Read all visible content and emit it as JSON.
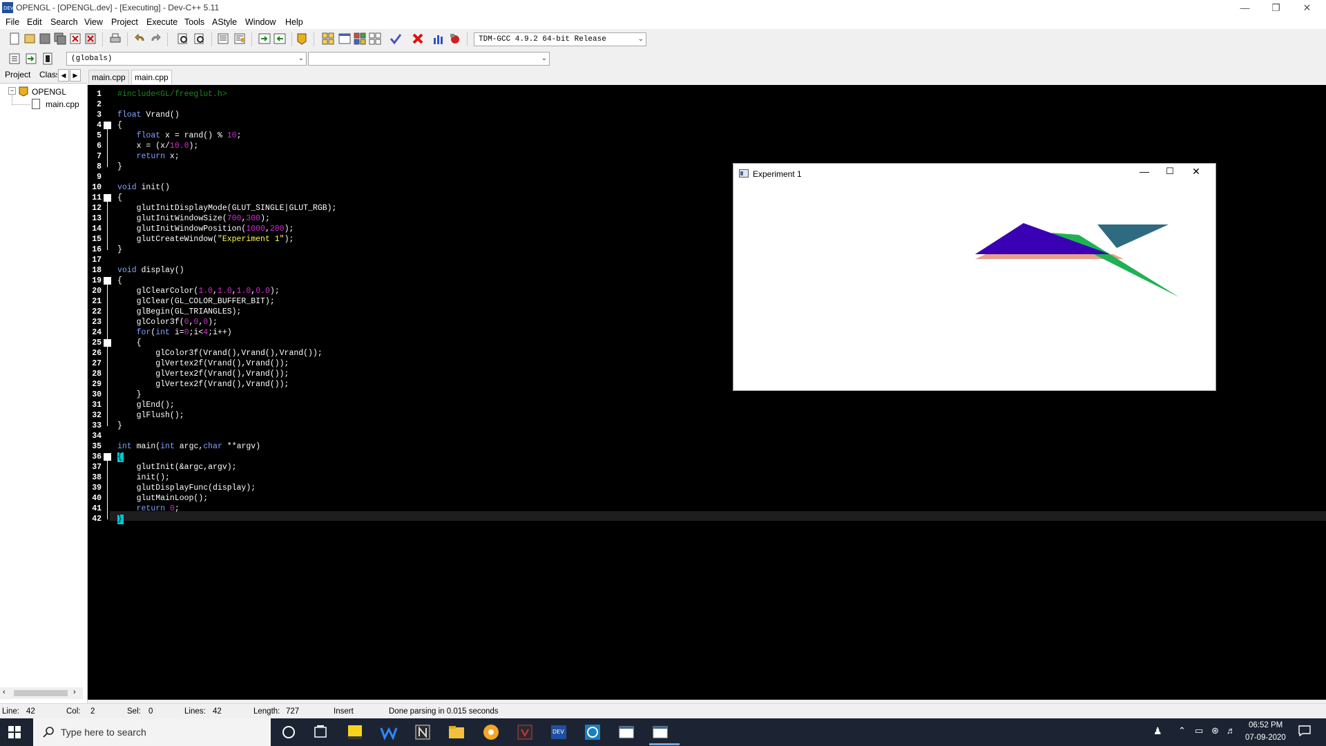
{
  "window": {
    "title": "OPENGL - [OPENGL.dev] - [Executing] - Dev-C++ 5.11"
  },
  "menu": [
    "File",
    "Edit",
    "Search",
    "View",
    "Project",
    "Execute",
    "Tools",
    "AStyle",
    "Window",
    "Help"
  ],
  "toolbar": {
    "compiler": "TDM-GCC 4.9.2 64-bit Release",
    "scope": "(globals)",
    "function_select": ""
  },
  "left_panel": {
    "tabs": [
      "Project",
      "Class"
    ],
    "tree": {
      "project": "OPENGL",
      "file": "main.cpp"
    }
  },
  "editor": {
    "tabs": [
      "main.cpp",
      "main.cpp"
    ],
    "lines": [
      "#include<GL/freeglut.h>",
      "",
      "float Vrand()",
      "{",
      "    float x = rand() % 10;",
      "    x = (x/10.0);",
      "    return x;",
      "}",
      "",
      "void init()",
      "{",
      "    glutInitDisplayMode(GLUT_SINGLE|GLUT_RGB);",
      "    glutInitWindowSize(700,300);",
      "    glutInitWindowPosition(1000,200);",
      "    glutCreateWindow(\"Experiment 1\");",
      "}",
      "",
      "void display()",
      "{",
      "    glClearColor(1.0,1.0,1.0,0.0);",
      "    glClear(GL_COLOR_BUFFER_BIT);",
      "    glBegin(GL_TRIANGLES);",
      "    glColor3f(0,0,0);",
      "    for(int i=0;i<4;i++)",
      "    {",
      "        glColor3f(Vrand(),Vrand(),Vrand());",
      "        glVertex2f(Vrand(),Vrand());",
      "        glVertex2f(Vrand(),Vrand());",
      "        glVertex2f(Vrand(),Vrand());",
      "    }",
      "    glEnd();",
      "    glFlush();",
      "}",
      "",
      "int main(int argc,char **argv)",
      "{",
      "    glutInit(&argc,argv);",
      "    init();",
      "    glutDisplayFunc(display);",
      "    glutMainLoop();",
      "    return 0;",
      "}"
    ]
  },
  "popup": {
    "title": "Experiment 1",
    "triangle_colors": [
      "#3a00b4",
      "#1fb255",
      "#e8a08a",
      "#2e6b80"
    ]
  },
  "status": {
    "line_label": "Line:",
    "line": "42",
    "col_label": "Col:",
    "col": "2",
    "sel_label": "Sel:",
    "sel": "0",
    "lines_label": "Lines:",
    "lines": "42",
    "length_label": "Length:",
    "length": "727",
    "mode": "Insert",
    "message": "Done parsing in 0.015 seconds"
  },
  "taskbar": {
    "search_placeholder": "Type here to search",
    "time": "06:52 PM",
    "date": "07-09-2020"
  }
}
